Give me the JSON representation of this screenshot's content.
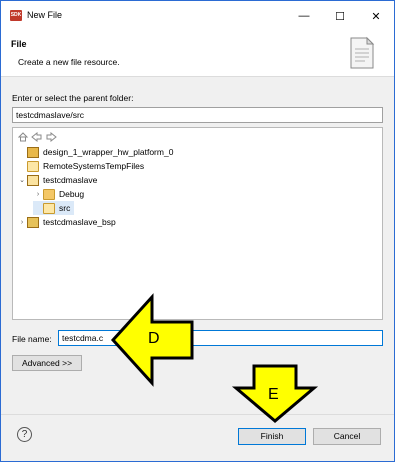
{
  "window": {
    "app_icon_text": "SDK",
    "title": "New File",
    "controls": {
      "minimize": "—",
      "maximize": "☐",
      "close": "✕"
    }
  },
  "header": {
    "title": "File",
    "description": "Create a new file resource."
  },
  "parent_folder": {
    "label": "Enter or select the parent folder:",
    "value": "testcdmaslave/src"
  },
  "tree": {
    "items": [
      {
        "label": "design_1_wrapper_hw_platform_0",
        "icon": "hw-platform-icon"
      },
      {
        "label": "RemoteSystemsTempFiles",
        "icon": "remote-systems-icon"
      },
      {
        "label": "testcdmaslave",
        "icon": "project-folder-icon",
        "expanded": true
      },
      {
        "label": "Debug",
        "icon": "folder-icon",
        "expanded": false
      },
      {
        "label": "src",
        "icon": "folder-open-icon",
        "selected": true
      },
      {
        "label": "testcdmaslave_bsp",
        "icon": "bsp-project-icon",
        "expanded": false
      }
    ]
  },
  "file_name": {
    "label": "File name:",
    "value": "testcdma.c"
  },
  "buttons": {
    "advanced": "Advanced >>",
    "finish": "Finish",
    "cancel": "Cancel",
    "help": "?"
  },
  "annotations": {
    "d": "D",
    "e": "E",
    "color": "#ffff00"
  }
}
